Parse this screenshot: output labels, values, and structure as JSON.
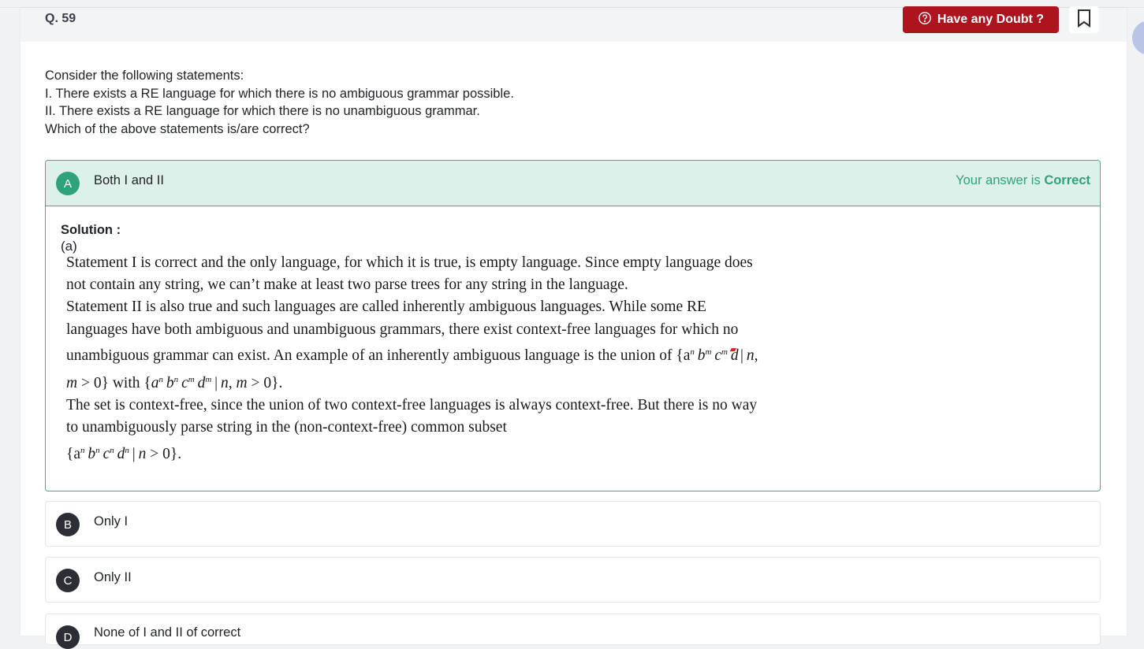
{
  "question": {
    "number": "Q. 59",
    "lines": [
      "Consider the following statements:",
      "I. There exists a RE language for which there is no ambiguous grammar possible.",
      "II. There exists a RE language for which there is no unambiguous grammar.",
      "Which of the above statements is/are correct?"
    ]
  },
  "header": {
    "doubt_label": "Have any Doubt ?",
    "doubt_icon": "question-bubble-icon",
    "bookmark_icon": "bookmark-icon"
  },
  "options": [
    {
      "letter": "A",
      "text": "Both I and II",
      "state": "correct"
    },
    {
      "letter": "B",
      "text": "Only I"
    },
    {
      "letter": "C",
      "text": "Only II"
    },
    {
      "letter": "D",
      "text": "None of I and II of correct"
    }
  ],
  "result": {
    "prefix": "Your answer is ",
    "status": "Correct"
  },
  "solution": {
    "title": "Solution :",
    "choice": "(a)",
    "para1": "Statement I is correct and the only language, for which it is true, is empty language. Since empty language does not contain any string, we can’t make at least two parse trees for any string in the language.",
    "para2_a": "Statement II is also true and such languages are called inherently ambiguous languages. While some RE languages have  both ambiguous and unambiguous grammars, there exist context-free languages for which no unambiguous grammar can exist. An example of an inherently ambiguous language is the union of ",
    "set1": "{a",
    "para2_with": " with ",
    "para3": "The set is context-free, since the union of two context-free languages is always context-free. But there is no way to unambiguously parse string in the (non-context-free) common subset",
    "set3": "{a"
  },
  "colors": {
    "accent_red": "#ad1420",
    "correct_green": "#2fa27b",
    "correct_bg": "#ddf0ea"
  }
}
